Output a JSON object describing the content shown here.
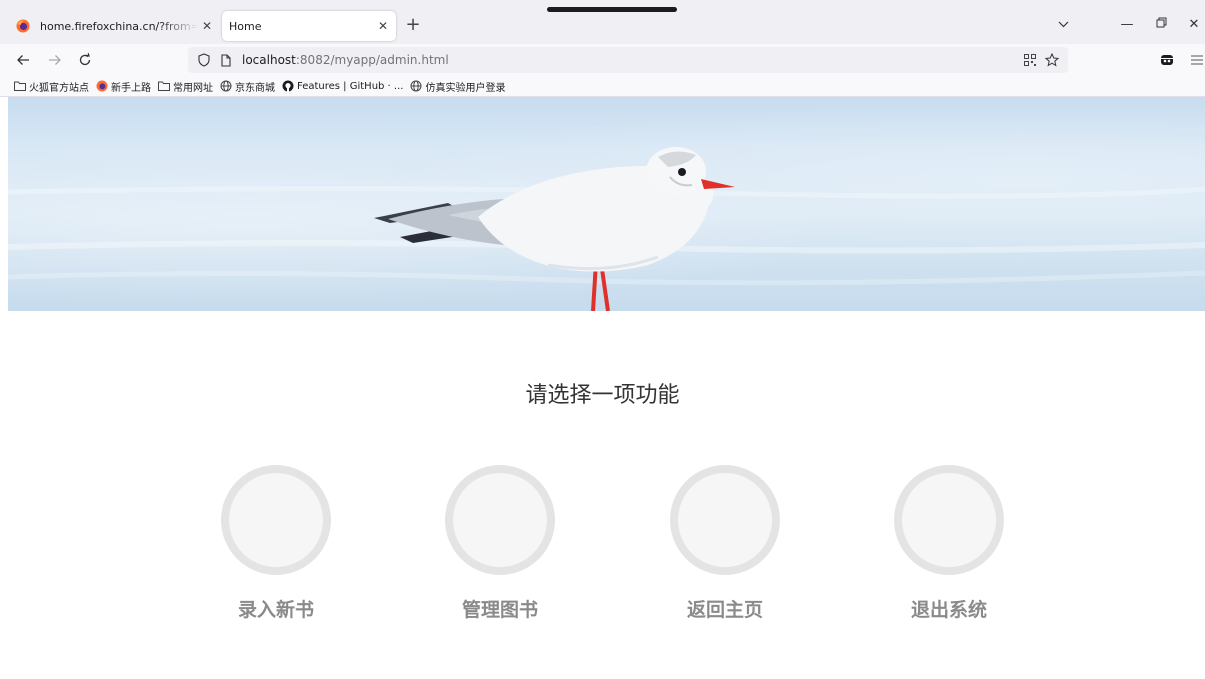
{
  "browser": {
    "tabs": [
      {
        "title": "home.firefoxchina.cn/?from=extra_start",
        "active": false
      },
      {
        "title": "Home",
        "active": true
      }
    ],
    "address": {
      "host": "localhost",
      "rest": ":8082/myapp/admin.html"
    },
    "bookmarks": [
      {
        "label": "火狐官方站点",
        "icon": "folder-icon"
      },
      {
        "label": "新手上路",
        "icon": "firefox-icon"
      },
      {
        "label": "常用网址",
        "icon": "folder-icon"
      },
      {
        "label": "京东商城",
        "icon": "globe-icon"
      },
      {
        "label": "Features | GitHub · ...",
        "icon": "github-icon"
      },
      {
        "label": "仿真实验用户登录",
        "icon": "globe-icon"
      }
    ]
  },
  "page": {
    "heading": "请选择一项功能",
    "functions": [
      {
        "label": "录入新书"
      },
      {
        "label": "管理图书"
      },
      {
        "label": "返回主页"
      },
      {
        "label": "退出系统"
      }
    ]
  },
  "colors": {
    "label": "#8a8a8a",
    "circle_border": "#e4e4e4",
    "beak": "#e0302a"
  }
}
